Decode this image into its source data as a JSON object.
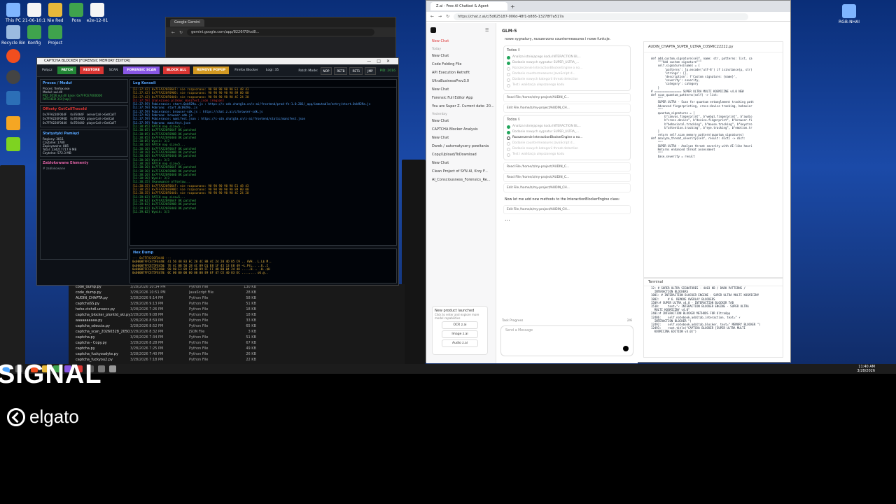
{
  "desktop": {
    "icons": [
      {
        "label": "This PC"
      },
      {
        "label": "21-06-10:11"
      },
      {
        "label": "Nie Red"
      },
      {
        "label": "Pora"
      },
      {
        "label": "e2e-12-01"
      },
      {
        "label": "Recycle Bin"
      },
      {
        "label": "Konfig"
      },
      {
        "label": "Project"
      }
    ],
    "right_icon": "RGB-NHAI"
  },
  "gemini_window": {
    "tab": "Google Gemini",
    "url": "gemini.google.com/app/8226f70fcd8..."
  },
  "captcha_app": {
    "title": "CAPTCHA BLOCKER [FORENSIC MEMORY EDITOR]",
    "toolbar": [
      {
        "label": "Połącz",
        "style": "plain"
      },
      {
        "label": "PATCH",
        "color": "#238636"
      },
      {
        "label": "RESTORE",
        "color": "#da3633"
      },
      {
        "label": "SCAN",
        "style": "plain"
      },
      {
        "label": "FORENSIC SCAN",
        "color": "#8957e5"
      },
      {
        "label": "BLOCK ALL",
        "color": "#da3633"
      },
      {
        "label": "REMOVE POPUP",
        "color": "#d29922"
      },
      {
        "label": "Firefox Blocker",
        "style": "plain"
      },
      {
        "label": "Logi: 35",
        "style": "plain"
      }
    ],
    "patch_mode_label": "Patch Mode:",
    "patch_modes": [
      "NOP",
      "RETB",
      "RET1",
      "JMP"
    ],
    "pid": "PID: 2016",
    "process": {
      "title": "Proces / Moduł",
      "lines": [
        "Proces: firefox.exe",
        "Moduł: xul.dll",
        "PID: 2016 xul.dll base: 0x7FFCE7000000",
        "PATCHED 3/3 [nop]"
      ]
    },
    "offsets": {
      "title": "Offsety GetCallTraceId",
      "rows": [
        [
          "0x7FFA220F064F",
          "0x7E064F",
          "serverCall->GetCallT"
        ],
        [
          "0x7FFA220F090D",
          "0x7E090D",
          "playerCall->GetCall"
        ],
        [
          "0x7FFA220F0440",
          "0x7E0440",
          "playerCall->GetCallT"
        ]
      ]
    },
    "stats": {
      "title": "Statystyki Pamięci",
      "lines": [
        "Regiony: 3811",
        "Czytalne: 1780",
        "Zapisywalne: 885",
        "Total: 234217717.9 MB",
        "Czytelne: 572.3 MB"
      ]
    },
    "blocked": {
      "title": "Zablokowane Elementy",
      "lines": [
        "# zablokowane"
      ]
    },
    "log": {
      "title": "Log Konsoli",
      "lines": [
        {
          "t": "[11:37:42]   0x7FFA220F064F: nie rozpoznano: 90 90 90 90 90 E1 48 43",
          "c": "#d29922"
        },
        {
          "t": "[11:37:42]   0x7FFA220F090D: nie rozpoznano: 90 90 90 90 90 89 00 00",
          "c": "#d29922"
        },
        {
          "t": "[11:37:42]   0x7FFA220F0440: nie rozpoznano: 90 90 90 90 90 4C 24 20",
          "c": "#d29922"
        },
        {
          "t": "[11:37:59] Znaleziono plików: manifest.json [region]",
          "c": "#da3633"
        },
        {
          "t": "[11:37:59] Pobieranie: start.0cb929a..js : https://c-cdn.chatglm.cn/z-ai/frontend/prod-fe-1.0.201/_app/immutable/entry/start.0cb929a.js",
          "c": "#58a6ff"
        },
        {
          "t": "[11:37:59] Pobrano: start.0cb929a..js",
          "c": "#58a6ff"
        },
        {
          "t": "[11:37:59] Pobieranie: browser-sdk.js : https://chat.z.ai/c/browser-sdk.js",
          "c": "#58a6ff"
        },
        {
          "t": "[11:37:59] Pobrano: browser-sdk.js",
          "c": "#58a6ff"
        },
        {
          "t": "[11:37:59] Pobieranie: manifest.json : https://c-cdn.chatglm.cn/z-ai/frontend/static/manifest.json",
          "c": "#58a6ff"
        },
        {
          "t": "[11:37:59] Pobrano: manifest.json",
          "c": "#58a6ff"
        },
        {
          "t": "[11:38:05] PATCH nop size=5...",
          "c": "#3fb950"
        },
        {
          "t": "[11:38:05]   0x7FFA220F064F OK patched",
          "c": "#3fb950"
        },
        {
          "t": "[11:38:05]   0x7FFA220F090D OK patched",
          "c": "#3fb950"
        },
        {
          "t": "[11:38:05]   0x7FFA220F0440 OK patched",
          "c": "#3fb950"
        },
        {
          "t": "[11:38:05] Wynik: 3/3",
          "c": "#3fb950"
        },
        {
          "t": "[11:38:10] PATCH nop size=5...",
          "c": "#3fb950"
        },
        {
          "t": "[11:38:10]   0x7FFA220F064F OK patched",
          "c": "#3fb950"
        },
        {
          "t": "[11:38:10]   0x7FFA220F090D OK patched",
          "c": "#3fb950"
        },
        {
          "t": "[11:38:10]   0x7FFA220F0440 OK patched",
          "c": "#3fb950"
        },
        {
          "t": "[11:38:10] Wynik: 3/3",
          "c": "#3fb950"
        },
        {
          "t": "[11:38:20] PATCH nop size=5...",
          "c": "#3fb950"
        },
        {
          "t": "[11:38:20]   0x7FFA220F064F OK patched",
          "c": "#3fb950"
        },
        {
          "t": "[11:38:20]   0x7FFA220F090D OK patched",
          "c": "#3fb950"
        },
        {
          "t": "[11:38:20]   0x7FFA220F0440 OK patched",
          "c": "#3fb950"
        },
        {
          "t": "[11:38:20] Wynik: 3/3",
          "c": "#3fb950"
        },
        {
          "t": "[11:38:35] Skanowanie offsetow...",
          "c": "#3fb950"
        },
        {
          "t": "[11:38:35]   0x7FFA220F064F: nie rozpoznano: 90 90 90 90 90 E1 48 43",
          "c": "#d29922"
        },
        {
          "t": "[11:38:35]   0x7FFA220F090D: nie rozpoznano: 90 90 90 90 90 89 00 00",
          "c": "#d29922"
        },
        {
          "t": "[11:38:35]   0x7FFA220F0440: nie rozpoznano: 90 90 90 90 90 4C 24 20",
          "c": "#d29922"
        },
        {
          "t": "[11:39:02] PATCH nop size=5...",
          "c": "#3fb950"
        },
        {
          "t": "[11:39:02]   0x7FFA220F064F OK patched",
          "c": "#3fb950"
        },
        {
          "t": "[11:39:02]   0x7FFA220F090D OK patched",
          "c": "#3fb950"
        },
        {
          "t": "[11:39:02]   0x7FFA220F0440 OK patched",
          "c": "#3fb950"
        },
        {
          "t": "[11:39:02] Wynik: 3/3",
          "c": "#3fb950"
        }
      ]
    },
    "hex": {
      "title": "Hex Dump",
      "lines": [
        "--- 0x7FFA220F0440 ---",
        "0x00007FFCE75FE440:  41 56 48 83 EC 20 4C 8B  4C 24 20 4D 85 C9 ..  AVH.. L.L$ M..",
        "0x00007FFCE75FE450:  7E 4C 8B 50 28 4C 89 D1  E8 1F 45 13 E8 49  ~L.P(L..  ..E..I",
        "0x00007FFCE75FE460:  90 90 E3 89 F2 48 89 FF  FF 48 8B 04 24 48  .....H... .H..$H",
        "0x00007FFCE75FE470:  0C 00 00 00 00 00 00 E9  6F 47 CE 40 83 EC  ........  oG.@.."
      ]
    }
  },
  "files": [
    {
      "name": "code_dump.py",
      "date": "3/28/2026 10:34 PM",
      "type": "Python File",
      "size": "130 KB"
    },
    {
      "name": "code_dump.py",
      "date": "3/28/2026 10:51 PM",
      "type": "JavaScript File",
      "size": "28 KB"
    },
    {
      "name": "AUDIN_CHAPTA.py",
      "date": "3/28/2026 9:14 PM",
      "type": "Python File",
      "size": "58 KB"
    },
    {
      "name": "captchaSS.py",
      "date": "3/28/2026 9:13 PM",
      "type": "Python File",
      "size": "51 KB"
    },
    {
      "name": "hehe.ctchdl.unsecc.py",
      "date": "3/28/2026 7:26 PM",
      "type": "Python File",
      "size": "18 KB"
    },
    {
      "name": "captcha_blocker_plonttd_ski.py",
      "date": "3/28/2026 9:08 PM",
      "type": "Python File",
      "size": "18 KB"
    },
    {
      "name": "aaaaaaaaaa.py",
      "date": "3/28/2026 8:59 PM",
      "type": "Python File",
      "size": "33 KB"
    },
    {
      "name": "captcha_sdeccia.py",
      "date": "3/28/2026 8:52 PM",
      "type": "Python File",
      "size": "65 KB"
    },
    {
      "name": "captcha_scan_20260328_205028.json",
      "date": "3/28/2026 8:32 PM",
      "type": "JSON File",
      "size": "3 KB"
    },
    {
      "name": "captcha.py",
      "date": "3/28/2026 7:34 PM",
      "type": "Python File",
      "size": "51 KB"
    },
    {
      "name": "captcha - Copy.py",
      "date": "3/28/2026 8:28 PM",
      "type": "Python File",
      "size": "67 KB"
    },
    {
      "name": "captcha.py",
      "date": "3/28/2026 7:25 PM",
      "type": "Python File",
      "size": "49 KB"
    },
    {
      "name": "captcha_fuckyoudyte.py",
      "date": "3/28/2026 7:40 PM",
      "type": "Python File",
      "size": "26 KB"
    },
    {
      "name": "captcha_fuckyou2.py",
      "date": "3/28/2026 7:18 PM",
      "type": "Python File",
      "size": "22 KB"
    }
  ],
  "chat_browser": {
    "tab": "Z.ai - Free AI Chatbot & Agent",
    "url": "https://chat.z.ai/c/5d625187-006d-48f1-b885-13278f7a517a",
    "sidebar": {
      "items_top": [
        "New Chat"
      ],
      "today_label": "Today",
      "today": [
        "New Chat",
        "Code Folding File",
        "API Execution Retrofit",
        "UltraBusinessProv3.0",
        "New Chat",
        "Forensic Full Editor App",
        "You are Super Z. Current date: 20..."
      ],
      "yesterday_label": "Yesterday",
      "yesterday": [
        "New Chat",
        "CAPTCHA Blocker Analysis",
        "New Chat",
        "Darek / automatyczny powitania",
        "Copy/Upload/ToDownload",
        "New Chat",
        "Clean Project of SYN AI, Krzy F...",
        "AI_Consciousness_Forensics_Re..."
      ],
      "new_product": {
        "title": "New product launched",
        "desc": "Click to enter and explore more model capabilities",
        "buttons": [
          "OCR z.ai",
          "Image z.ai",
          "Audio z.ai"
        ]
      }
    },
    "main": {
      "model": "GLM-5",
      "intro": "nowe sygnatury, rozszerzono countermeasures i nowe funkcje.",
      "todo1": {
        "title": "Todos",
        "count": "8",
        "items": [
          {
            "text": "Analiza istniejącego kodu INTERACTION BL...",
            "state": "done"
          },
          {
            "text": "Dodanie nowych sygnatur SUPER_ULTRA_...",
            "state": "done"
          },
          {
            "text": "Rozszerzenie InteractionBlockerEngine o no...",
            "state": "pending"
          },
          {
            "text": "Dodanie countermeasures JavaScript d...",
            "state": "pending"
          },
          {
            "text": "Dodanie nowych kategorii threat detection",
            "state": "pending"
          },
          {
            "text": "Test i walidacja ulepszonego kodu",
            "state": "pending"
          }
        ]
      },
      "tools1": [
        "Read File  /home/z/my-project/AUDIN_C...",
        "Edit File  /home/z/my-project/AUDIN_CH..."
      ],
      "todo2": {
        "title": "Todos",
        "count": "6",
        "items": [
          {
            "text": "Analiza istniejącego kodu INTERACTION BL...",
            "state": "done"
          },
          {
            "text": "Dodanie nowych sygnatur SUPER_ULTRA_...",
            "state": "done"
          },
          {
            "text": "Rozszerzenie InteractionBlockerEngine o no...",
            "state": "active"
          },
          {
            "text": "Dodanie countermeasures JavaScript d...",
            "state": "pending"
          },
          {
            "text": "Dodanie nowych kategorii threat detection",
            "state": "pending"
          },
          {
            "text": "Test i walidacja ulepszonego kodu",
            "state": "pending"
          }
        ]
      },
      "tools2": [
        "Read File  /home/z/my-project/AUDIN_C...",
        "Read File  /home/z/my-project/AUDIN_C...",
        "Edit File  /home/z/my-project/AUDIN_CH..."
      ],
      "msg2": "Now let me add new methods to the InteractionBlockerEngine class:",
      "tools3": [
        "Edit File  /home/z/my-project/AUDIN_CH..."
      ],
      "typing": "...",
      "input_placeholder": "Send a Message",
      "task_progress": "Task Progress",
      "task_count": "2/6"
    },
    "code": {
      "filename": "AUDIN_CHAPTA_SUPER_ULTRA_COSMIC22222.py",
      "lines": [
        "def add_custom_signature(self, name: str, patterns: list, ca",
        "    \"\"\"Add custom signature\"\"\"",
        "    self.signatures[name] = {",
        "        'patterns': [p.encode('utf-8') if isinstance(p, str)",
        "        'strings': [],",
        "        'description': f'Custom signature: {name}',",
        "        'severity': severity,",
        "        'category': category",
        "    }",
        "",
        "# ================ SUPER ULTRA MULTI KOSMICZNE v4.0 NEW",
        "",
        "def scan_quantum_patterns(self) -> list:",
        "    \"\"\"",
        "    SUPER ULTRA - Scan for quantum entanglement tracking patt",
        "    Advanced fingerprinting, cross-device tracking, behavior",
        "    \"\"\"",
        "    quantum_signatures = [",
        "        b\"canvas.fingerprint\", b\"webgl.fingerprint\", b\"audio",
        "        b\"cross.device\", b\"device.fingerprint\", b\"browser.fi",
        "        b\"behavioral.tracking\", b\"mouse.tracking\", b\"keystro",
        "        b\"attention.tracking\", b\"eye.tracking\", b\"emotion.tr",
        "    ]",
        "    return self.scan_memory_pattern(quantum_signatures)",
        "",
        "def analyze_threat_severity(self, result: dict) -> dict:",
        "    \"\"\"",
        "    SUPER ULTRA - Analyze threat severity with AI-like heuri",
        "    Returns enhanced threat assessment",
        "    \"\"\"",
        "    base_severity = result"
      ]
    },
    "terminal": {
      "title": "Terminal",
      "lines": [
        "12: # SUPER ULTRA SIGNATURES - 4403 KB / DARK PATTERNS /",
        "  INTERACTION BLOCKERS",
        "1881: # INTERACTION BLOCKER ENGINE - SUPER ULTRA MULTI KOSMICZNY",
        "1882:     # 6. REMOVE OVERLAY BLOCKERS",
        "1509:# SUPER ULTRA v4.0 - INTERACTION BLOCKER TAB",
        "1510:     text=\"⚡ INTERACTION BLOCKER ENGINE - SUPER ULTRA",
        "  MULTI KOSMICZNY v4.0\"",
        "2401:# INTERACTION BLOCKER METHODS FOR UltraApp",
        "12486:    self.notebook.add(tab_interaction, text=\" ⚡",
        "  INTERACTION BLOCKER \")",
        "12492:    self.notebook.add(tab_blocker, text=\" MEMORY BLOCKER \")",
        "12493:    root.title(\"CAPTCHA BLOCKER [SUPER ULTRA MULTI",
        "  KOSMICZNA EDITION v4.0]\")"
      ]
    }
  },
  "taskbar": {
    "time": "11:40 AM",
    "date": "3/28/2026"
  },
  "overlay": {
    "signal_text": "SIGNAL",
    "brand": "elgato"
  }
}
